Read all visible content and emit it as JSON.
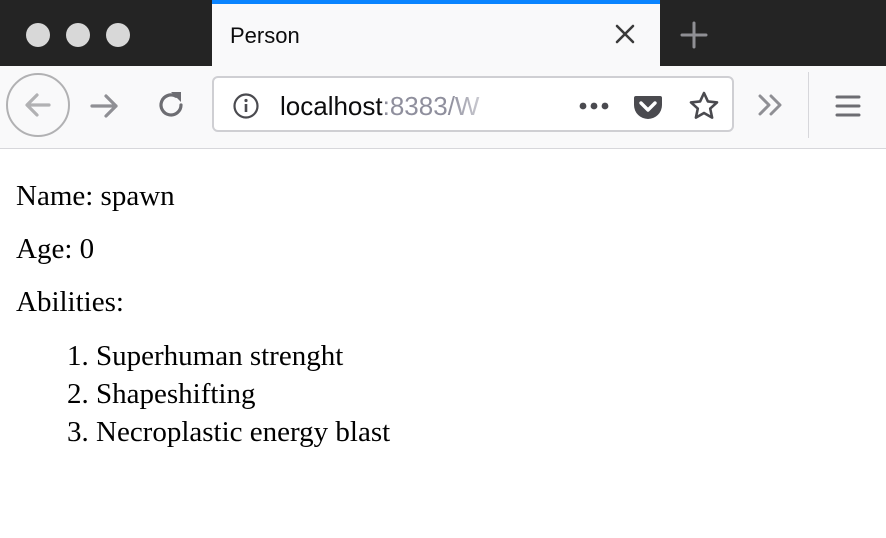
{
  "browser": {
    "tab": {
      "title": "Person"
    },
    "urlbar": {
      "host": "localhost",
      "port_path": ":8383/W"
    },
    "accent_color": "#0a84ff",
    "icons": {
      "window_controls": [
        "close-dot",
        "minimize-dot",
        "zoom-dot"
      ],
      "tab_close": "close-icon",
      "new_tab": "plus-icon",
      "back": "arrow-left-icon",
      "forward": "arrow-right-icon",
      "reload": "reload-icon",
      "site_info": "info-icon",
      "page_actions": "ellipsis-icon",
      "pocket": "pocket-icon",
      "bookmark": "star-icon",
      "overflow": "double-chevron-icon",
      "menu": "hamburger-icon"
    }
  },
  "page": {
    "name_line": "Name: spawn",
    "age_line": "Age: 0",
    "abilities_heading": "Abilities:",
    "abilities": [
      "Superhuman strenght",
      "Shapeshifting",
      "Necroplastic energy blast"
    ]
  }
}
